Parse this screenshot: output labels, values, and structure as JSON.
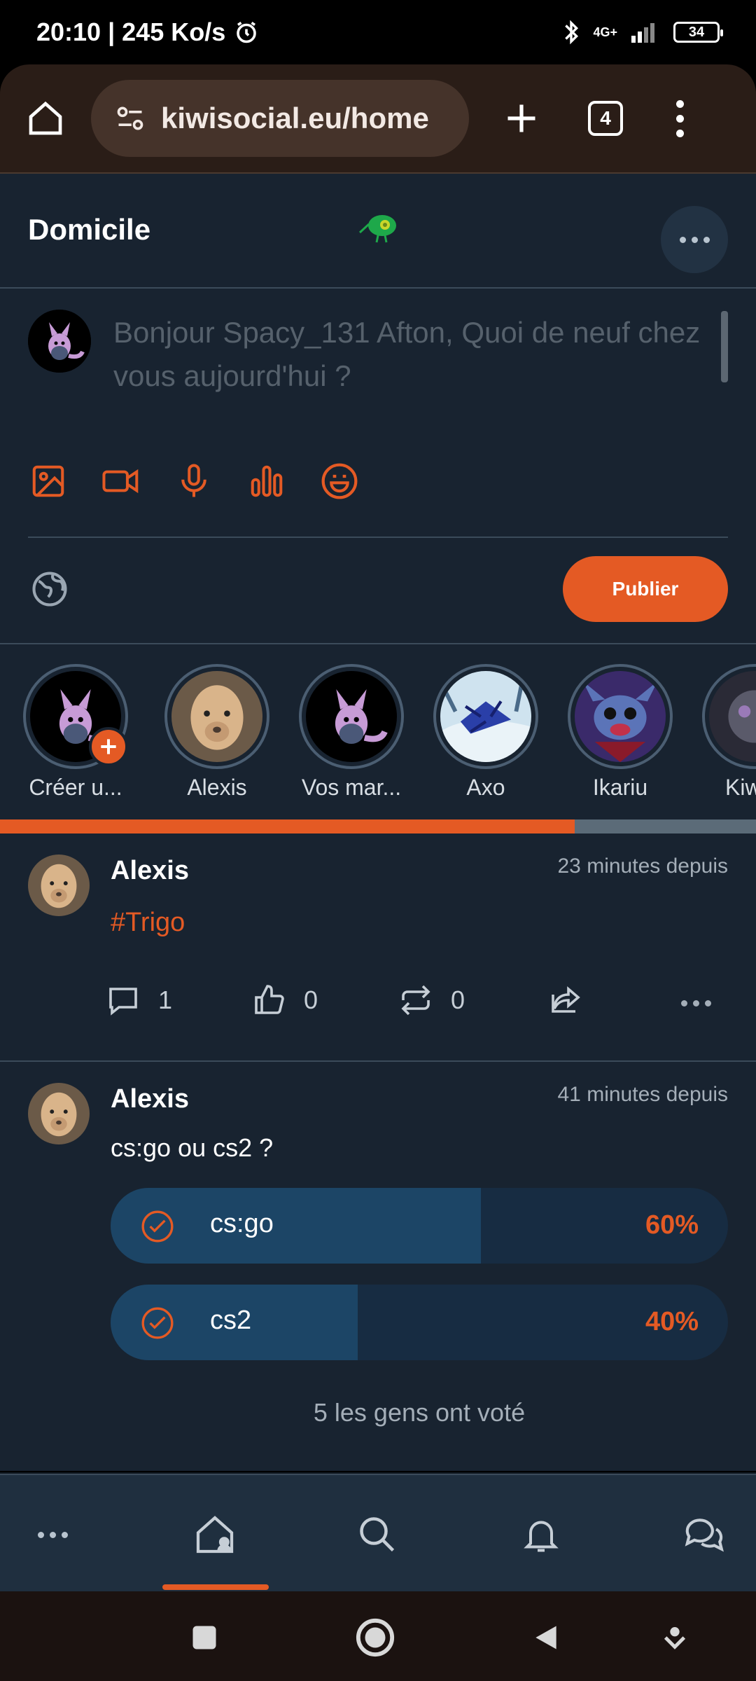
{
  "status_bar": {
    "time_speed": "20:10 | 245 Ko/s",
    "network": "4G+",
    "battery": "34"
  },
  "browser": {
    "url": "kiwisocial.eu/home",
    "tab_count": "4"
  },
  "header": {
    "title": "Domicile"
  },
  "composer": {
    "placeholder": "Bonjour Spacy_131 Afton, Quoi de neuf chez vous aujourd'hui ?",
    "publish_label": "Publier"
  },
  "stories": [
    {
      "label": "Créer u..."
    },
    {
      "label": "Alexis"
    },
    {
      "label": "Vos mar..."
    },
    {
      "label": "Axo"
    },
    {
      "label": "Ikariu"
    },
    {
      "label": "Kiw"
    }
  ],
  "story_progress_percent": 76,
  "posts": [
    {
      "author": "Alexis",
      "time": "23 minutes depuis",
      "hashtag": "#Trigo",
      "comments": "1",
      "likes": "0",
      "reposts": "0"
    },
    {
      "author": "Alexis",
      "time": "41 minutes depuis",
      "text": "cs:go ou cs2 ?",
      "poll": [
        {
          "label": "cs:go",
          "percent_text": "60%",
          "percent": 60
        },
        {
          "label": "cs2",
          "percent_text": "40%",
          "percent": 40
        }
      ],
      "votes_text": "5 les gens ont voté"
    }
  ],
  "colors": {
    "accent": "#e45a24",
    "background": "#182330",
    "browser_bar": "#2a1d17"
  }
}
